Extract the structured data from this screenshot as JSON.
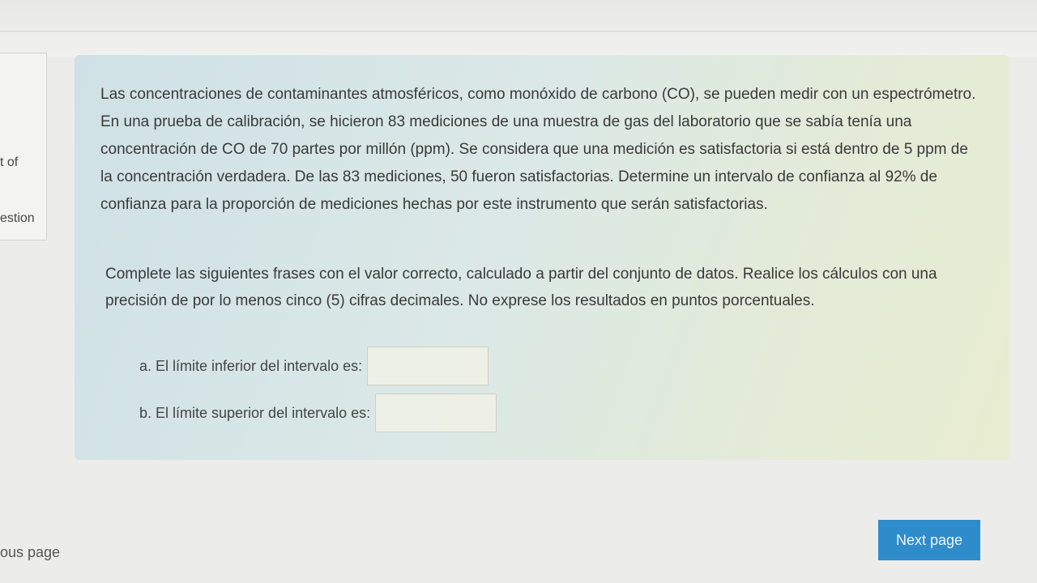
{
  "sidebar": {
    "fragment_1": "t of",
    "fragment_2": "estion"
  },
  "question": {
    "paragraph_1": "Las concentraciones de contaminantes atmosféricos, como monóxido de carbono (CO), se pueden medir con un espectrómetro. En una prueba de calibración, se hicieron 83 mediciones de una muestra de gas del laboratorio que se sabía tenía una concentración de CO de 70 partes por millón (ppm). Se considera que una medición es satisfactoria si está dentro de 5 ppm de la concentración verdadera. De las 83 mediciones, 50 fueron satisfactorias. Determine un intervalo de confianza al 92% de confianza para la proporción de mediciones hechas por este instrumento que serán satisfactorias.",
    "paragraph_2": "Complete las siguientes frases con el valor correcto, calculado a partir del conjunto de datos. Realice los cálculos con una precisión de por lo menos cinco (5) cifras decimales. No exprese los resultados en puntos porcentuales.",
    "item_a_label": "a. El límite inferior del intervalo es:",
    "item_a_value": "",
    "item_b_label": "b. El límite superior del intervalo es:",
    "item_b_value": ""
  },
  "navigation": {
    "previous_label": "ous page",
    "next_label": "Next page"
  },
  "colors": {
    "next_button": "#2f8ccb",
    "panel": "#dbe8e6"
  }
}
